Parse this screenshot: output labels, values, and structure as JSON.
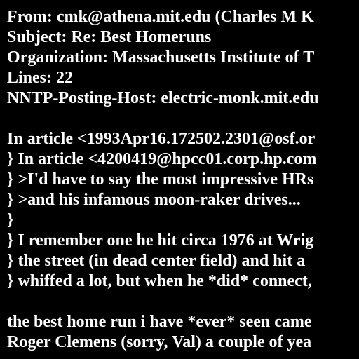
{
  "header": {
    "from": "From: cmk@athena.mit.edu (Charles M K",
    "subject": "Subject: Re: Best Homeruns",
    "organization": "Organization: Massachusetts Institute of T",
    "lines": "Lines: 22",
    "nntp_posting_host": "NNTP-Posting-Host: electric-monk.mit.edu"
  },
  "body": {
    "quote_lines": [
      "In article <1993Apr16.172502.2301@osf.or",
      "} In article <4200419@hpcc01.corp.hp.com",
      "} >I'd have to say the most impressive HRs",
      "} >and his infamous moon-raker drives...",
      "}",
      "} I remember one he hit circa 1976 at Wrig",
      "} the street (in dead center field) and hit a",
      "} whiffed a lot, but when he *did* connect,"
    ],
    "reply_lines": [
      "the best home run i have *ever* seen came",
      "Roger Clemens (sorry, Val) a couple of yea"
    ]
  },
  "colors": {
    "background": "#000000",
    "text": "#ffffff"
  }
}
